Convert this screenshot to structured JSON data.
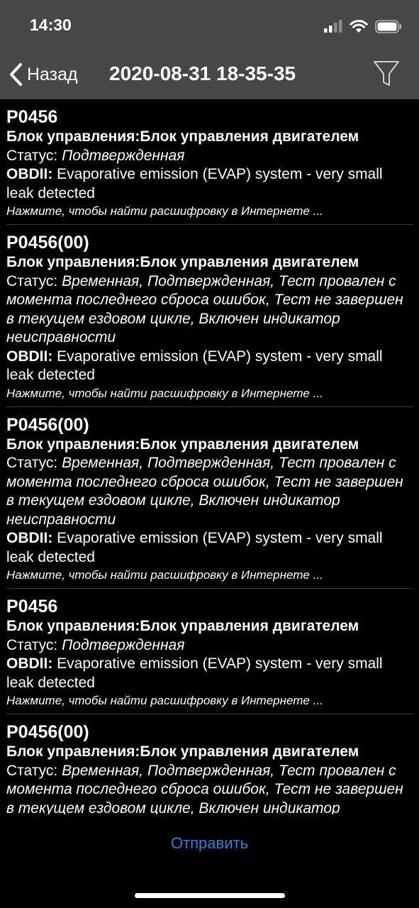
{
  "status_bar": {
    "time": "14:30",
    "signal_icon": "cellular-signal-icon",
    "wifi_icon": "wifi-icon",
    "battery_icon": "battery-icon"
  },
  "nav": {
    "back_label": "Назад",
    "back_icon": "chevron-left-icon",
    "title": "2020-08-31 18-35-35",
    "filter_icon": "filter-icon"
  },
  "labels": {
    "block_label": "Блок управления:",
    "status_label": "Статус:",
    "obd_label": "OBDII:"
  },
  "entries": [
    {
      "code": "P0456",
      "block": "Блок управления двигателем",
      "status": "Подтвержденная",
      "obd": "Evaporative emission (EVAP) system - very small leak detected",
      "hint": "Нажмите, чтобы найти расшифровку в Интернете ..."
    },
    {
      "code": "P0456(00)",
      "block": "Блок управления двигателем",
      "status": "Временная, Подтвержденная, Тест провален с момента последнего сброса ошибок, Тест не завершен в текущем ездовом цикле, Включен индикатор неисправности",
      "obd": "Evaporative emission (EVAP) system - very small leak detected",
      "hint": "Нажмите, чтобы найти расшифровку в Интернете ..."
    },
    {
      "code": "P0456(00)",
      "block": "Блок управления двигателем",
      "status": "Временная, Подтвержденная, Тест провален с момента последнего сброса ошибок, Тест не завершен в текущем ездовом цикле, Включен индикатор неисправности",
      "obd": "Evaporative emission (EVAP) system - very small leak detected",
      "hint": "Нажмите, чтобы найти расшифровку в Интернете ..."
    },
    {
      "code": "P0456",
      "block": "Блок управления двигателем",
      "status": "Подтвержденная",
      "obd": "Evaporative emission (EVAP) system - very small leak detected",
      "hint": "Нажмите, чтобы найти расшифровку в Интернете ..."
    },
    {
      "code": "P0456(00)",
      "block": "Блок управления двигателем",
      "status": "Временная, Подтвержденная, Тест провален с момента последнего сброса ошибок, Тест не завершен в текущем ездовом цикле, Включен индикатор неисправности",
      "obd": "",
      "hint": ""
    }
  ],
  "footer": {
    "send_label": "Отправить"
  }
}
